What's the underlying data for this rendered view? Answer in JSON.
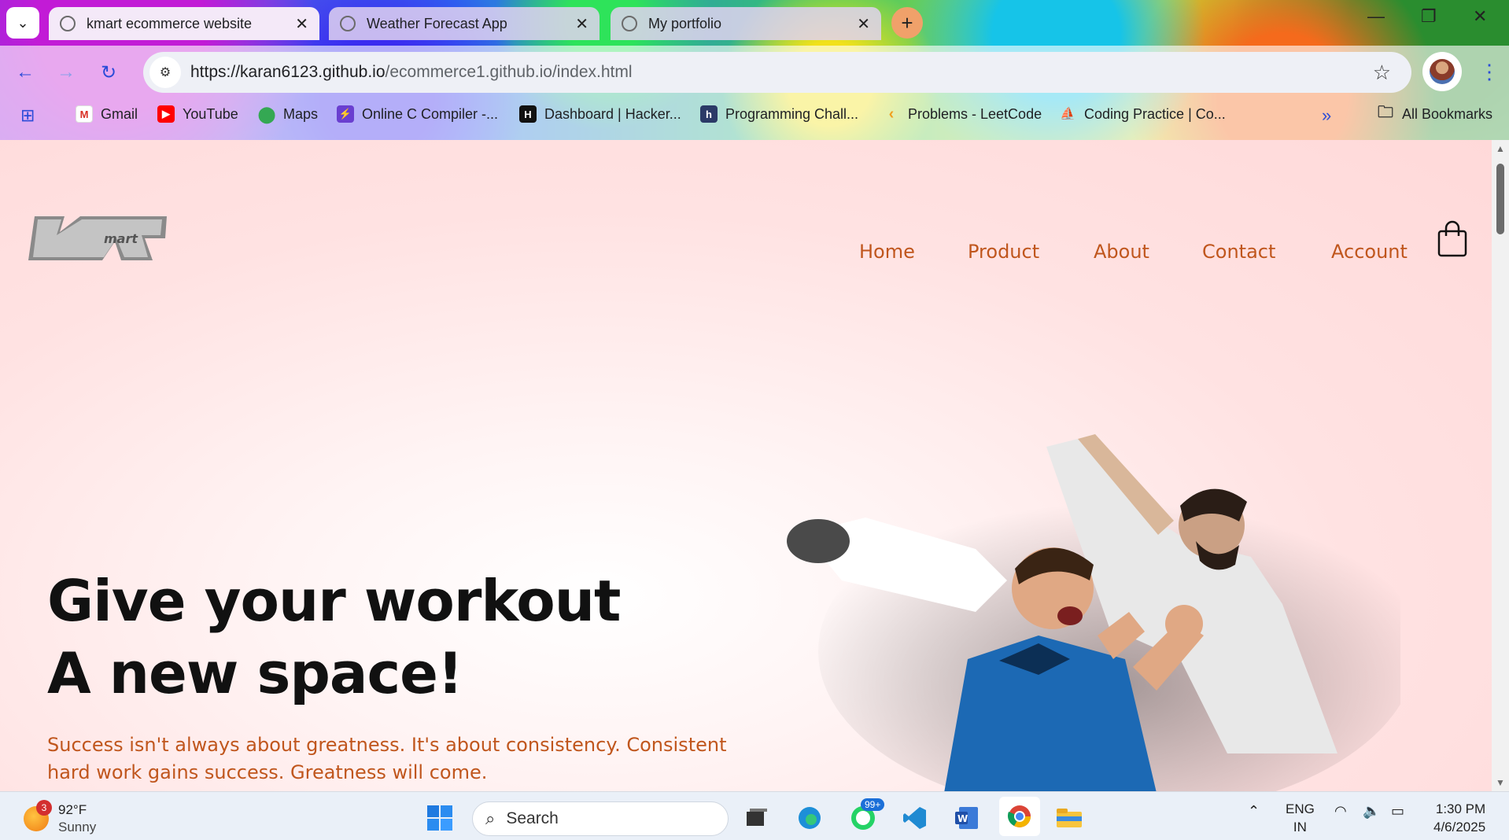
{
  "browser": {
    "tabs": [
      {
        "label": "kmart ecommerce website",
        "active": true
      },
      {
        "label": "Weather Forecast App",
        "active": false
      },
      {
        "label": "My portfolio",
        "active": false
      }
    ],
    "url_host": "https://karan6123.github.io",
    "url_path": "/ecommerce1.github.io/index.html",
    "bookmarks": [
      "Gmail",
      "YouTube",
      "Maps",
      "Online C Compiler -...",
      "Dashboard | Hacker...",
      "Programming Chall...",
      "Problems - LeetCode",
      "Coding Practice | Co..."
    ],
    "all_bookmarks": "All Bookmarks",
    "more_bookmarks": "»"
  },
  "site": {
    "logo_text": "mart",
    "nav": [
      "Home",
      "Product",
      "About",
      "Contact",
      "Account"
    ],
    "hero_title_line1": "Give your workout",
    "hero_title_line2": "A new space!",
    "hero_text": "Success isn't always about greatness. It's about consistency. Consistent hard work gains success. Greatness will come.",
    "accent_color": "#c0561d"
  },
  "taskbar": {
    "weather_badge": "3",
    "temperature": "92°F",
    "condition": "Sunny",
    "search_placeholder": "Search",
    "whatsapp_badge": "99+",
    "lang_line1": "ENG",
    "lang_line2": "IN",
    "time": "1:30 PM",
    "date": "4/6/2025"
  }
}
